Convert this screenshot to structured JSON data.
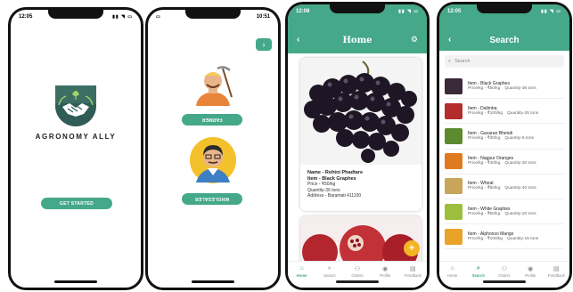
{
  "phone1": {
    "time": "12:05",
    "brand": "AGRONOMY ALLY",
    "cta": "GET STARTED"
  },
  "phone2": {
    "time": "10:51",
    "farmer_button": "FARMER",
    "wholesaler_button": "WHOLESALER"
  },
  "phone3": {
    "time": "12:08",
    "title": "Home",
    "listing": {
      "name": "Name - Rohini Phadtare",
      "item": "Item - Black Graphes",
      "price": "Price - ₹50/kg",
      "quantity": "Quantity-36 tons",
      "address": "Address - Baramati 411100"
    },
    "fab": "+"
  },
  "phone4": {
    "time": "12:05",
    "title": "Search",
    "search_placeholder": "Search",
    "items": [
      {
        "name": "Item - Black Graphes",
        "price": "Price/kg - ₹50/kg",
        "qty": "Quantity-36 tons",
        "color": "#3a2a3a"
      },
      {
        "name": "Item - Dalimba",
        "price": "Price/kg - ₹100/kg",
        "qty": "Quantity-25 tons",
        "color": "#b32d2d"
      },
      {
        "name": "Item - Gavaran Bhendi",
        "price": "Price/kg - ₹30/kg",
        "qty": "Quantity-5 tons",
        "color": "#5c8a2e"
      },
      {
        "name": "Item - Nagpur Oranges",
        "price": "Price/kg - ₹40/kg",
        "qty": "Quantity-30 tons",
        "color": "#e07a1f"
      },
      {
        "name": "Item - Wheat",
        "price": "Price/kg - ₹50/kg",
        "qty": "Quantity-40 tons",
        "color": "#c9a55a"
      },
      {
        "name": "Item - White Graphes",
        "price": "Price/kg - ₹60/kg",
        "qty": "Quantity-20 tons",
        "color": "#9bbf3c"
      },
      {
        "name": "Item - Alphonso Mango",
        "price": "Price/kg - ₹100/kg",
        "qty": "Quantity-15 tons",
        "color": "#e8a328"
      }
    ]
  },
  "nav": [
    {
      "label": "Home",
      "icon": "home-icon",
      "glyph": "⌂"
    },
    {
      "label": "Search",
      "icon": "search-icon",
      "glyph": "⌕"
    },
    {
      "label": "Orders",
      "icon": "orders-icon",
      "glyph": "⚇"
    },
    {
      "label": "Profile",
      "icon": "profile-icon",
      "glyph": "◉"
    },
    {
      "label": "Feedback",
      "icon": "feedback-icon",
      "glyph": "▤"
    }
  ],
  "colors": {
    "accent": "#44a889",
    "fab": "#f3b525"
  }
}
